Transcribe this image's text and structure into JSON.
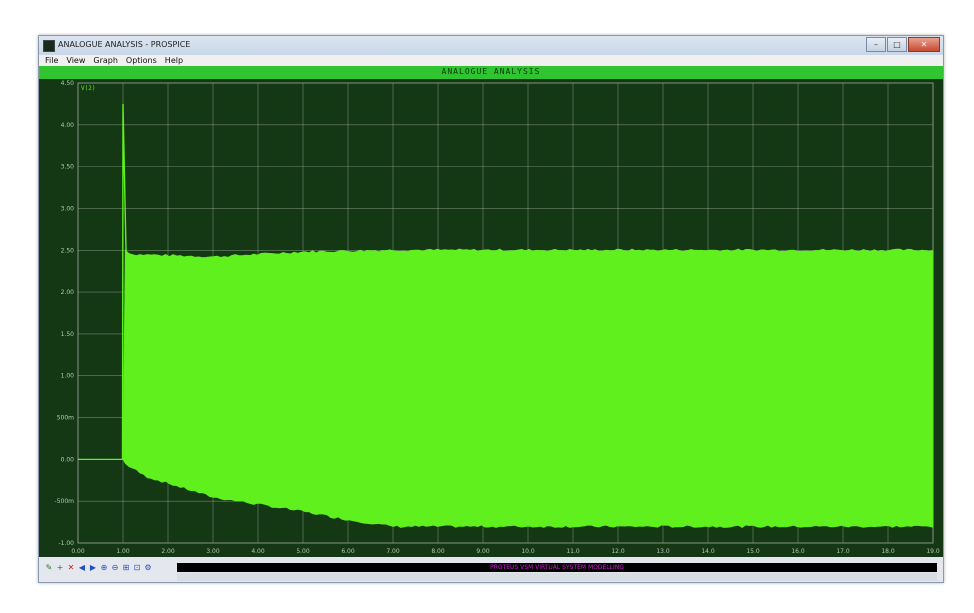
{
  "window": {
    "title": "ANALOGUE ANALYSIS - PROSPICE",
    "controls": {
      "minimize": "–",
      "maximize": "□",
      "close": "✕"
    }
  },
  "menu": [
    "File",
    "View",
    "Graph",
    "Options",
    "Help"
  ],
  "graph": {
    "title": "ANALOGUE ANALYSIS"
  },
  "status": {
    "text": "PROTEUS VSM  VIRTUAL SYSTEM MODELLING"
  },
  "toolbar_icons": [
    "graph-edit-icon",
    "graph-add-icon",
    "graph-delete-icon",
    "scroll-left-icon",
    "scroll-right-icon",
    "zoom-in-icon",
    "zoom-out-icon",
    "zoom-full-icon",
    "zoom-area-icon",
    "graph-settings-icon"
  ],
  "colors": {
    "plot_bg": "#143714",
    "trace": "#5ff01e",
    "header_strip": "#31c431",
    "grid": "#9aa89a",
    "status_text": "#d020d0"
  },
  "chart_data": {
    "type": "area",
    "title": "ANALOGUE ANALYSIS",
    "legend": "V(2)",
    "ylim": [
      -1.0,
      4.5
    ],
    "y_ticks": [
      "-1.00",
      "-500m",
      "0.00",
      "500m",
      "1.00",
      "1.50",
      "2.00",
      "2.50",
      "3.00",
      "3.50",
      "4.00",
      "4.50"
    ],
    "y_tick_values": [
      -1.0,
      -0.5,
      0.0,
      0.5,
      1.0,
      1.5,
      2.0,
      2.5,
      3.0,
      3.5,
      4.0,
      4.5
    ],
    "xlim": [
      0,
      19
    ],
    "x_ticks": [
      "0.00",
      "1.00",
      "2.00",
      "3.00",
      "4.00",
      "5.00",
      "6.00",
      "7.00",
      "8.00",
      "9.00",
      "10.0",
      "11.0",
      "12.0",
      "13.0",
      "14.0",
      "15.0",
      "16.0",
      "17.0",
      "18.0",
      "19.0"
    ],
    "x_tick_values": [
      0,
      1,
      2,
      3,
      4,
      5,
      6,
      7,
      8,
      9,
      10,
      11,
      12,
      13,
      14,
      15,
      16,
      17,
      18,
      19
    ],
    "initial_level": 0.0,
    "onset_x": 1.0,
    "spike_peak": 4.25,
    "upper_envelope": {
      "x": [
        1.05,
        1.2,
        3.0,
        5.0,
        7.0,
        19.0
      ],
      "y": [
        2.5,
        2.45,
        2.42,
        2.48,
        2.5,
        2.5
      ]
    },
    "lower_envelope": {
      "x": [
        1.05,
        1.5,
        3.0,
        5.0,
        6.0,
        7.0,
        19.0
      ],
      "y": [
        -0.05,
        -0.2,
        -0.45,
        -0.62,
        -0.72,
        -0.8,
        -0.8
      ]
    },
    "grid": true,
    "legend_position": "top-left"
  }
}
